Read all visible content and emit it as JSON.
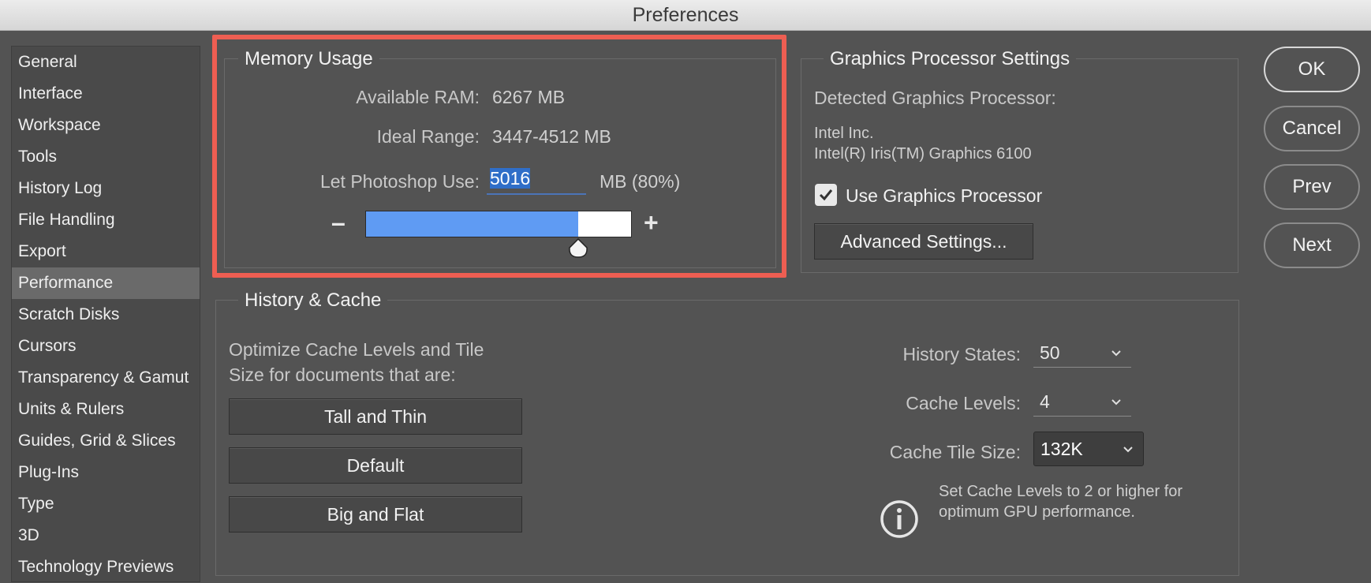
{
  "window": {
    "title": "Preferences"
  },
  "sidebar": {
    "items": [
      {
        "label": "General"
      },
      {
        "label": "Interface"
      },
      {
        "label": "Workspace"
      },
      {
        "label": "Tools"
      },
      {
        "label": "History Log"
      },
      {
        "label": "File Handling"
      },
      {
        "label": "Export"
      },
      {
        "label": "Performance",
        "selected": true
      },
      {
        "label": "Scratch Disks"
      },
      {
        "label": "Cursors"
      },
      {
        "label": "Transparency & Gamut"
      },
      {
        "label": "Units & Rulers"
      },
      {
        "label": "Guides, Grid & Slices"
      },
      {
        "label": "Plug-Ins"
      },
      {
        "label": "Type"
      },
      {
        "label": "3D"
      },
      {
        "label": "Technology Previews"
      }
    ]
  },
  "memory": {
    "title": "Memory Usage",
    "available_label": "Available RAM:",
    "available_value": "6267 MB",
    "ideal_label": "Ideal Range:",
    "ideal_value": "3447-4512 MB",
    "use_label": "Let Photoshop Use:",
    "use_value": "5016",
    "use_suffix": "MB (80%)",
    "slider_fraction": 0.8,
    "minus": "–",
    "plus": "+"
  },
  "gpu": {
    "title": "Graphics Processor Settings",
    "detected_label": "Detected Graphics Processor:",
    "vendor": "Intel Inc.",
    "model": "Intel(R) Iris(TM) Graphics 6100",
    "use_gpu_label": "Use Graphics Processor",
    "use_gpu_checked": true,
    "advanced_label": "Advanced Settings..."
  },
  "history_cache": {
    "title": "History & Cache",
    "optimize_line1": "Optimize Cache Levels and Tile",
    "optimize_line2": "Size for documents that are:",
    "buttons": [
      "Tall and Thin",
      "Default",
      "Big and Flat"
    ],
    "history_states_label": "History States:",
    "history_states_value": "50",
    "cache_levels_label": "Cache Levels:",
    "cache_levels_value": "4",
    "cache_tile_label": "Cache Tile Size:",
    "cache_tile_value": "132K",
    "note_line1": "Set Cache Levels to 2 or higher for",
    "note_line2": "optimum GPU performance."
  },
  "actions": {
    "ok": "OK",
    "cancel": "Cancel",
    "prev": "Prev",
    "next": "Next"
  },
  "colors": {
    "highlight": "#ee5e52",
    "slider_fill": "#5f9bf3",
    "background": "#535353"
  },
  "icons": {
    "info": "info-icon",
    "check": "checkmark-icon",
    "chevron": "chevron-down-icon"
  }
}
